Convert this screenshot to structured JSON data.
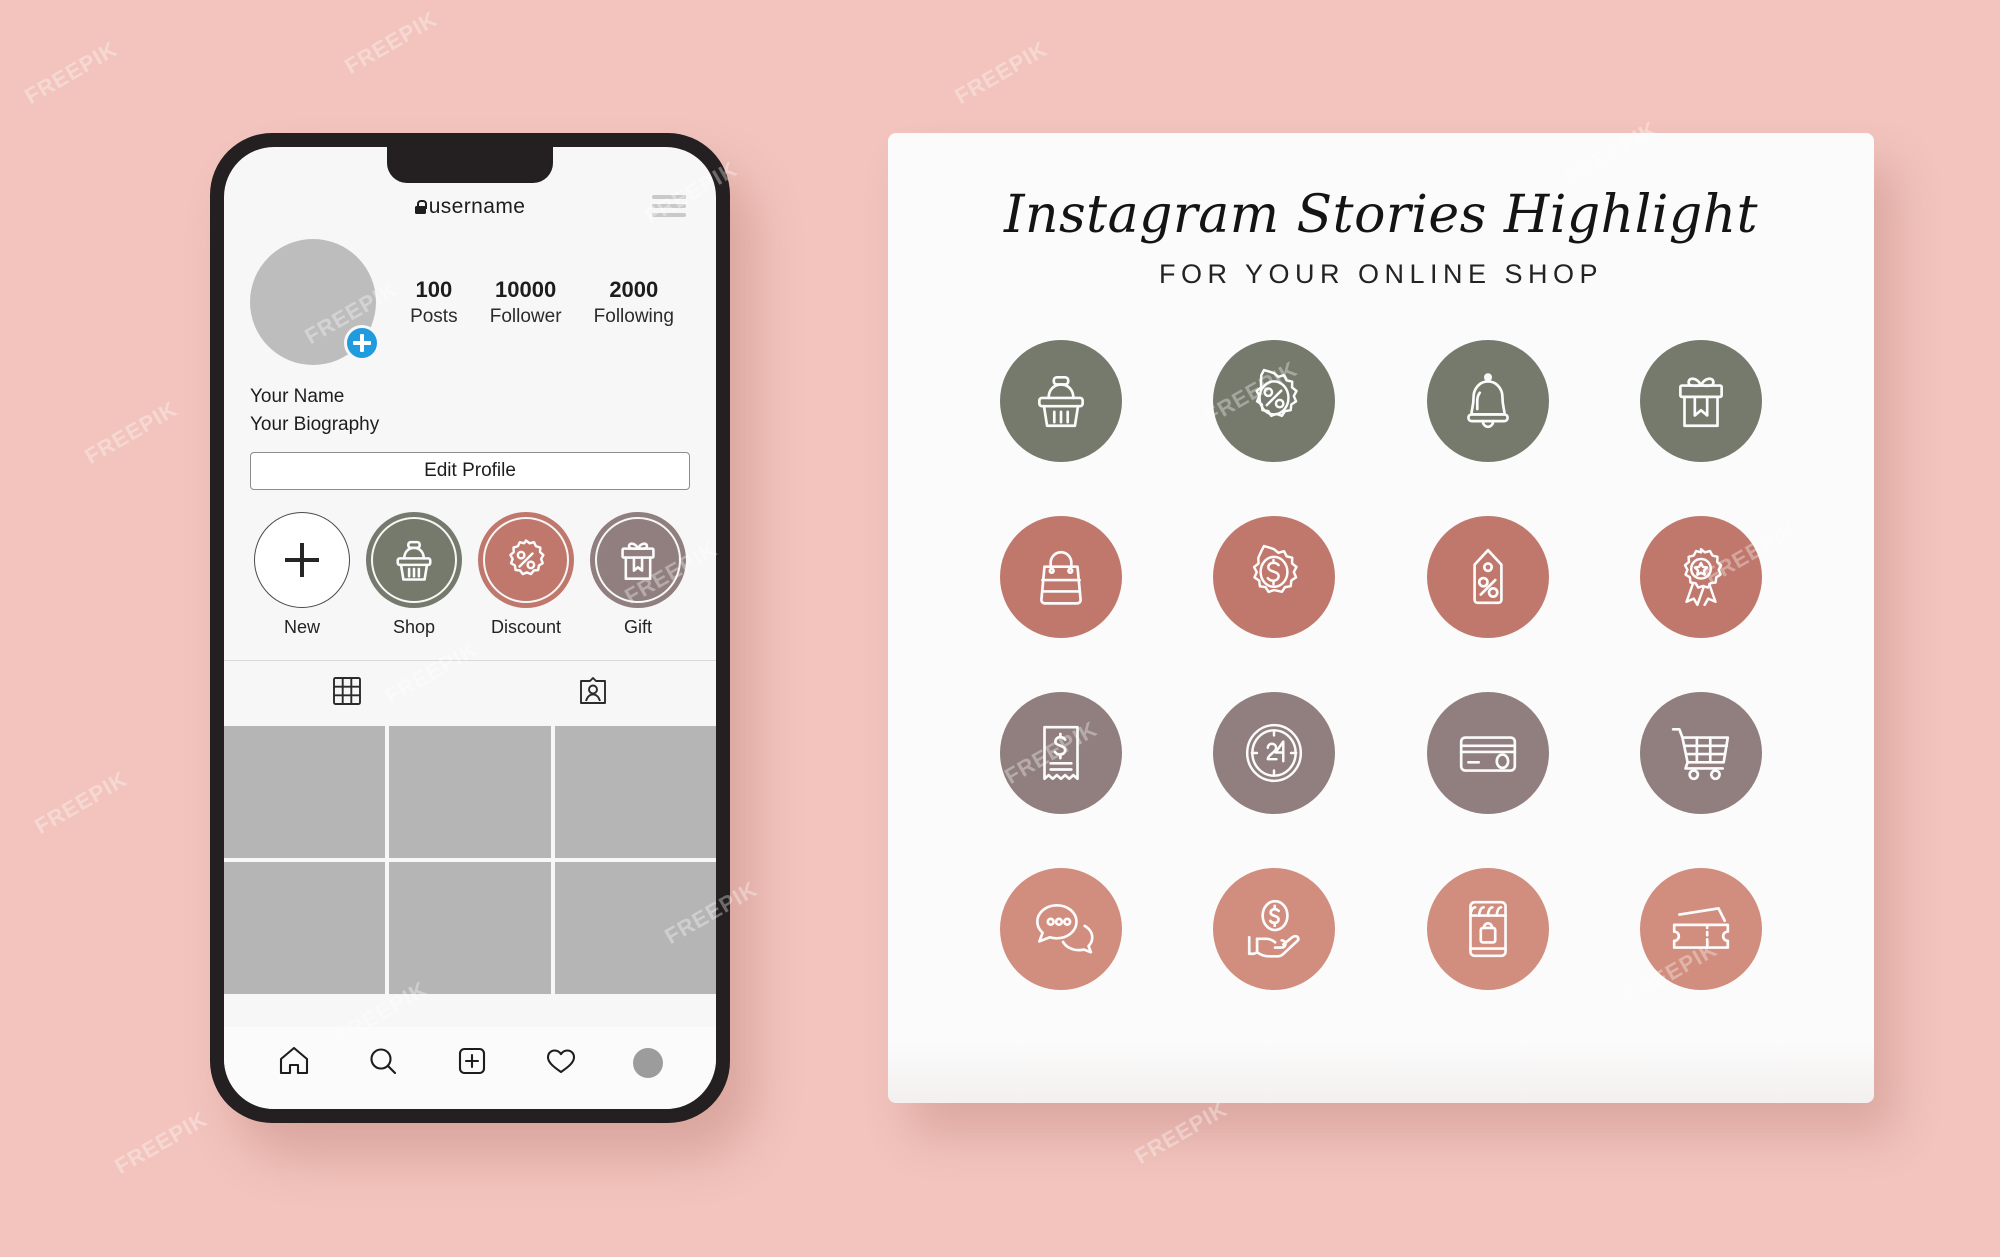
{
  "theme": {
    "background": "#f2c4bd",
    "card_bg": "#fbfbfb",
    "phone_frame": "#241f20",
    "screen_bg": "#f7f7f7",
    "accent_blue": "#1f9bde",
    "row_colors": [
      "#767a6c",
      "#c0786d",
      "#907f7e",
      "#d18d7e"
    ]
  },
  "watermarks": [
    "FREEPIK",
    "FREEPIK",
    "FREEPIK",
    "FREEPIK",
    "FREEPIK",
    "FREEPIK",
    "FREEPIK",
    "FREEPIK",
    "FREEPIK",
    "FREEPIK",
    "FREEPIK",
    "FREEPIK",
    "FREEPIK",
    "FREEPIK",
    "FREEPIK",
    "FREEPIK",
    "FREEPIK",
    "FREEPIK"
  ],
  "phone": {
    "header": {
      "username": "username",
      "lock_icon": "lock-icon",
      "menu_icon": "hamburger-menu-icon"
    },
    "profile": {
      "avatar_icon": "avatar-placeholder",
      "add_story_icon": "plus-badge-icon",
      "stats": [
        {
          "number": "100",
          "label": "Posts"
        },
        {
          "number": "10000",
          "label": "Follower"
        },
        {
          "number": "2000",
          "label": "Following"
        }
      ],
      "name": "Your Name",
      "biography": "Your Biography",
      "edit_button": "Edit Profile"
    },
    "highlights": [
      {
        "label": "New",
        "icon": "plus-icon",
        "style": "new"
      },
      {
        "label": "Shop",
        "icon": "shopping-basket-icon",
        "color": "#767a6c"
      },
      {
        "label": "Discount",
        "icon": "discount-badge-icon",
        "color": "#c0786d"
      },
      {
        "label": "Gift",
        "icon": "gift-box-icon",
        "color": "#907f7e"
      }
    ],
    "tabs": [
      {
        "name": "grid-tab",
        "icon": "grid-icon"
      },
      {
        "name": "tagged-tab",
        "icon": "tagged-person-icon"
      }
    ],
    "grid_cells": 6,
    "nav": [
      {
        "name": "nav-home",
        "icon": "home-icon"
      },
      {
        "name": "nav-search",
        "icon": "search-icon"
      },
      {
        "name": "nav-add",
        "icon": "add-post-icon"
      },
      {
        "name": "nav-activity",
        "icon": "heart-icon"
      },
      {
        "name": "nav-profile",
        "icon": "profile-avatar-icon"
      }
    ]
  },
  "card": {
    "title": "Instagram Stories Highlight",
    "subtitle": "FOR YOUR ONLINE SHOP",
    "icons": [
      {
        "icon": "shopping-basket-icon",
        "color": "#767a6c"
      },
      {
        "icon": "discount-badge-percent-icon",
        "color": "#767a6c"
      },
      {
        "icon": "notification-bell-icon",
        "color": "#767a6c"
      },
      {
        "icon": "gift-box-icon",
        "color": "#767a6c"
      },
      {
        "icon": "shopping-bag-icon",
        "color": "#c0786d"
      },
      {
        "icon": "dollar-coin-badge-icon",
        "color": "#c0786d"
      },
      {
        "icon": "price-tag-percent-icon",
        "color": "#c0786d"
      },
      {
        "icon": "award-ribbon-icon",
        "color": "#c0786d"
      },
      {
        "icon": "receipt-dollar-icon",
        "color": "#907f7e"
      },
      {
        "icon": "24-hours-clock-icon",
        "color": "#907f7e"
      },
      {
        "icon": "credit-card-icon",
        "color": "#907f7e"
      },
      {
        "icon": "shopping-cart-icon",
        "color": "#907f7e"
      },
      {
        "icon": "chat-bubbles-icon",
        "color": "#d18d7e"
      },
      {
        "icon": "hand-holding-coin-icon",
        "color": "#d18d7e"
      },
      {
        "icon": "mobile-storefront-icon",
        "color": "#d18d7e"
      },
      {
        "icon": "tickets-icon",
        "color": "#d18d7e"
      }
    ]
  }
}
